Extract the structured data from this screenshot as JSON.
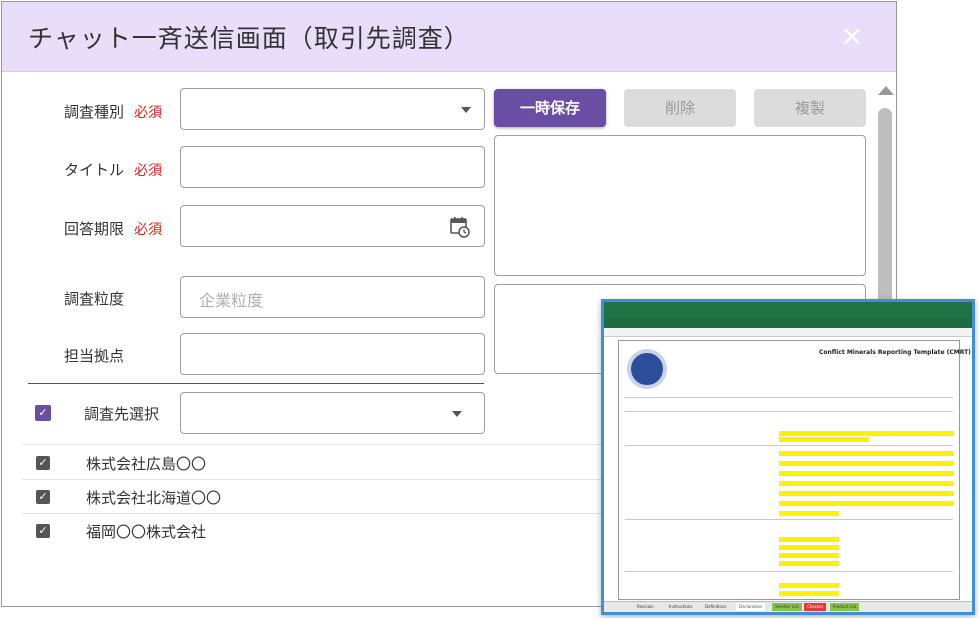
{
  "dialog": {
    "title": "チャット一斉送信画面（取引先調査）",
    "close_glyph": "×"
  },
  "form": {
    "required_mark": "必須",
    "survey_type": {
      "label": "調査種別",
      "value": ""
    },
    "title": {
      "label": "タイトル",
      "value": ""
    },
    "deadline": {
      "label": "回答期限",
      "value": ""
    },
    "granularity": {
      "label": "調査粒度",
      "placeholder": "企業粒度"
    },
    "site": {
      "label": "担当拠点",
      "value": ""
    }
  },
  "actions": {
    "save_label": "一時保存",
    "delete_label": "削除",
    "duplicate_label": "複製"
  },
  "targets": {
    "select_label": "調査先選択",
    "select_all_checked": true,
    "rows": [
      {
        "name": "株式会社広島〇〇",
        "checked": true
      },
      {
        "name": "株式会社北海道〇〇",
        "checked": true
      },
      {
        "name": "福岡〇〇株式会社",
        "checked": true
      }
    ]
  },
  "overlay": {
    "heading": "Conflict Minerals Reporting Template (CMRT)",
    "sheet_tabs": [
      "Revision",
      "Instructions",
      "Definitions",
      "Declaration",
      "Smelter List",
      "Checker",
      "Product List"
    ]
  },
  "colors": {
    "title_bar": "#e9defa",
    "primary": "#6a4ea3",
    "required": "#e0261f",
    "disabled": "#dcdcdc"
  },
  "icons": {
    "close": "close-icon",
    "dropdown": "chevron-down-icon",
    "calendar": "calendar-clock-icon",
    "checkbox": "checkbox-checked-icon"
  }
}
